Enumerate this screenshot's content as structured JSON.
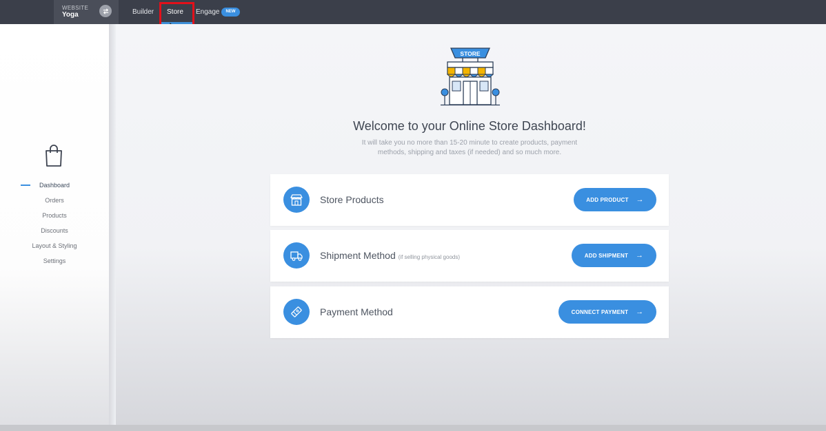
{
  "topbar": {
    "site_caption": "WEBSITE",
    "site_name": "Yoga",
    "nav": [
      {
        "label": "Builder",
        "active": false
      },
      {
        "label": "Store",
        "active": true
      },
      {
        "label": "Engage",
        "active": false
      }
    ],
    "badge": "NEW"
  },
  "sidebar": {
    "items": [
      {
        "label": "Dashboard",
        "active": true
      },
      {
        "label": "Orders",
        "active": false
      },
      {
        "label": "Products",
        "active": false
      },
      {
        "label": "Discounts",
        "active": false
      },
      {
        "label": "Layout & Styling",
        "active": false
      },
      {
        "label": "Settings",
        "active": false
      }
    ]
  },
  "main": {
    "store_sign": "STORE",
    "title": "Welcome to your Online Store Dashboard!",
    "subtitle_line1": "It will take you no more than 15-20 minute to create products, payment",
    "subtitle_line2": "methods, shipping and taxes (if needed) and so much more.",
    "cards": [
      {
        "title": "Store Products",
        "note": "",
        "button": "ADD PRODUCT",
        "icon": "store-icon"
      },
      {
        "title": "Shipment Method",
        "note": "(if selling physical goods)",
        "button": "ADD SHIPMENT",
        "icon": "truck-icon"
      },
      {
        "title": "Payment Method",
        "note": "",
        "button": "CONNECT PAYMENT",
        "icon": "payment-tag-icon"
      }
    ],
    "arrow": "→"
  },
  "colors": {
    "accent": "#3a8fe0",
    "topbar": "#3b3f4a",
    "highlight": "#e3101a"
  }
}
